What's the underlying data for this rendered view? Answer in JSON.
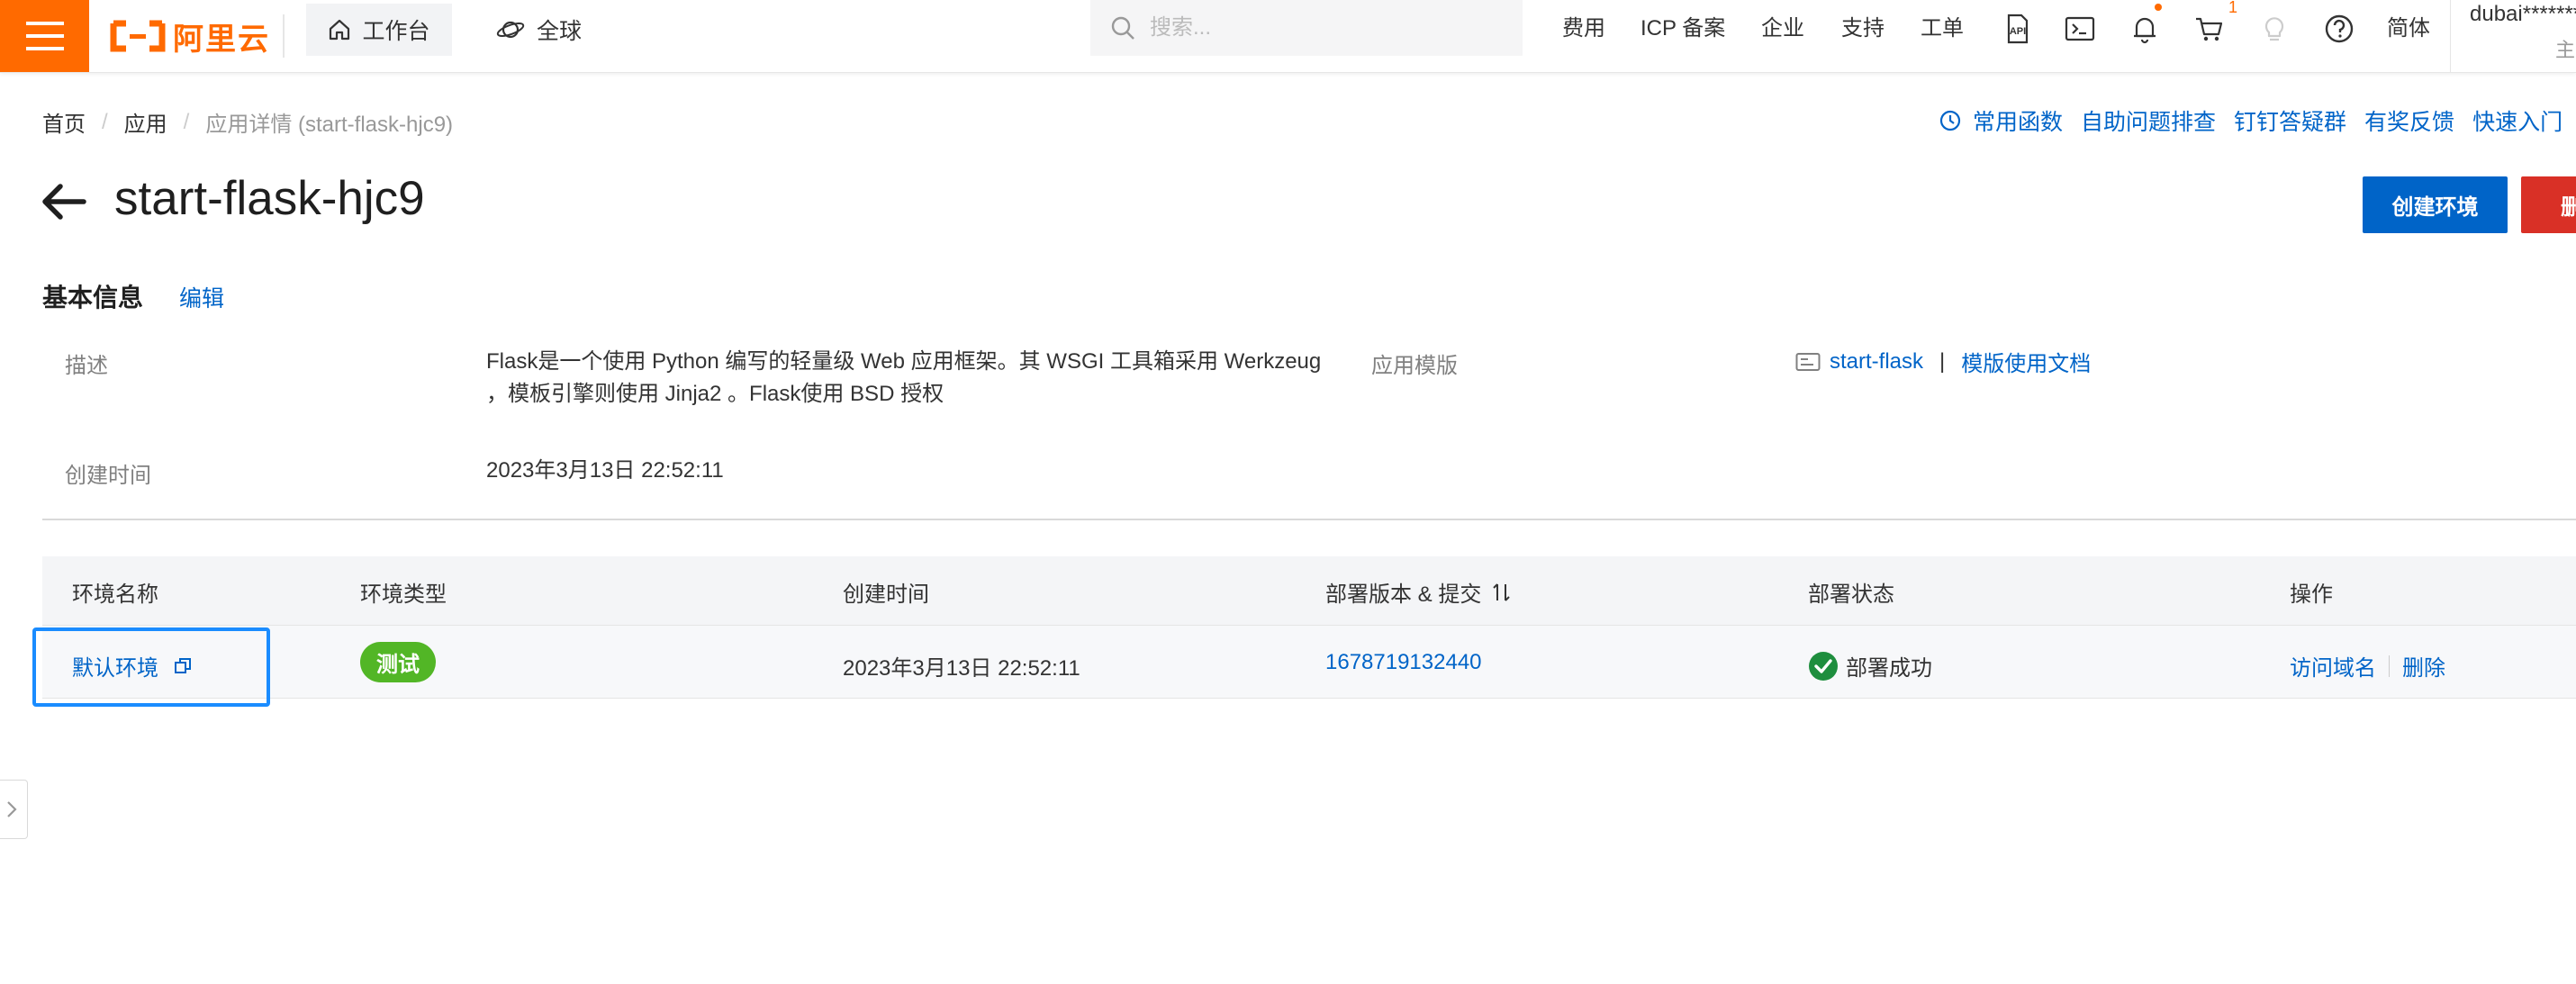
{
  "topbar": {
    "brand": "阿里云",
    "workbench": "工作台",
    "region": "全球",
    "search_placeholder": "搜索...",
    "links": {
      "fees": "费用",
      "icp": "ICP 备案",
      "enterprise": "企业",
      "support": "支持",
      "ticket": "工单",
      "language": "简体"
    },
    "cart_badge": "1",
    "user": "dubai*******",
    "user_sub": "主"
  },
  "breadcrumb": {
    "home": "首页",
    "apps": "应用",
    "current": "应用详情 (start-flask-hjc9)"
  },
  "quick_links": [
    "常用函数",
    "自助问题排查",
    "钉钉答疑群",
    "有奖反馈",
    "快速入门"
  ],
  "page": {
    "title": "start-flask-hjc9",
    "create_env_button": "创建环境",
    "delete_button": "删除"
  },
  "basic_info": {
    "title": "基本信息",
    "edit": "编辑",
    "desc_label": "描述",
    "desc_line1": "Flask是一个使用 Python 编写的轻量级 Web 应用框架。其 WSGI 工具箱采用 Werkzeug",
    "desc_line2": "，模板引擎则使用 Jinja2 。Flask使用 BSD 授权",
    "template_label": "应用模版",
    "template_name": "start-flask",
    "template_sep": "|",
    "template_docs": "模版使用文档",
    "created_label": "创建时间",
    "created_value": "2023年3月13日 22:52:11"
  },
  "env_table": {
    "columns": {
      "name": "环境名称",
      "type": "环境类型",
      "created": "创建时间",
      "version": "部署版本 & 提交",
      "status": "部署状态",
      "ops": "操作"
    },
    "rows": [
      {
        "name": "默认环境",
        "type": "测试",
        "created": "2023年3月13日 22:52:11",
        "version": "1678719132440",
        "status": "部署成功",
        "op_domain": "访问域名",
        "op_delete": "删除"
      }
    ]
  },
  "colors": {
    "brand_orange": "#ff6a00",
    "link_blue": "#0064c8",
    "success_green": "#52b626",
    "danger_red": "#d93026",
    "highlight_blue": "#1a8cff"
  }
}
